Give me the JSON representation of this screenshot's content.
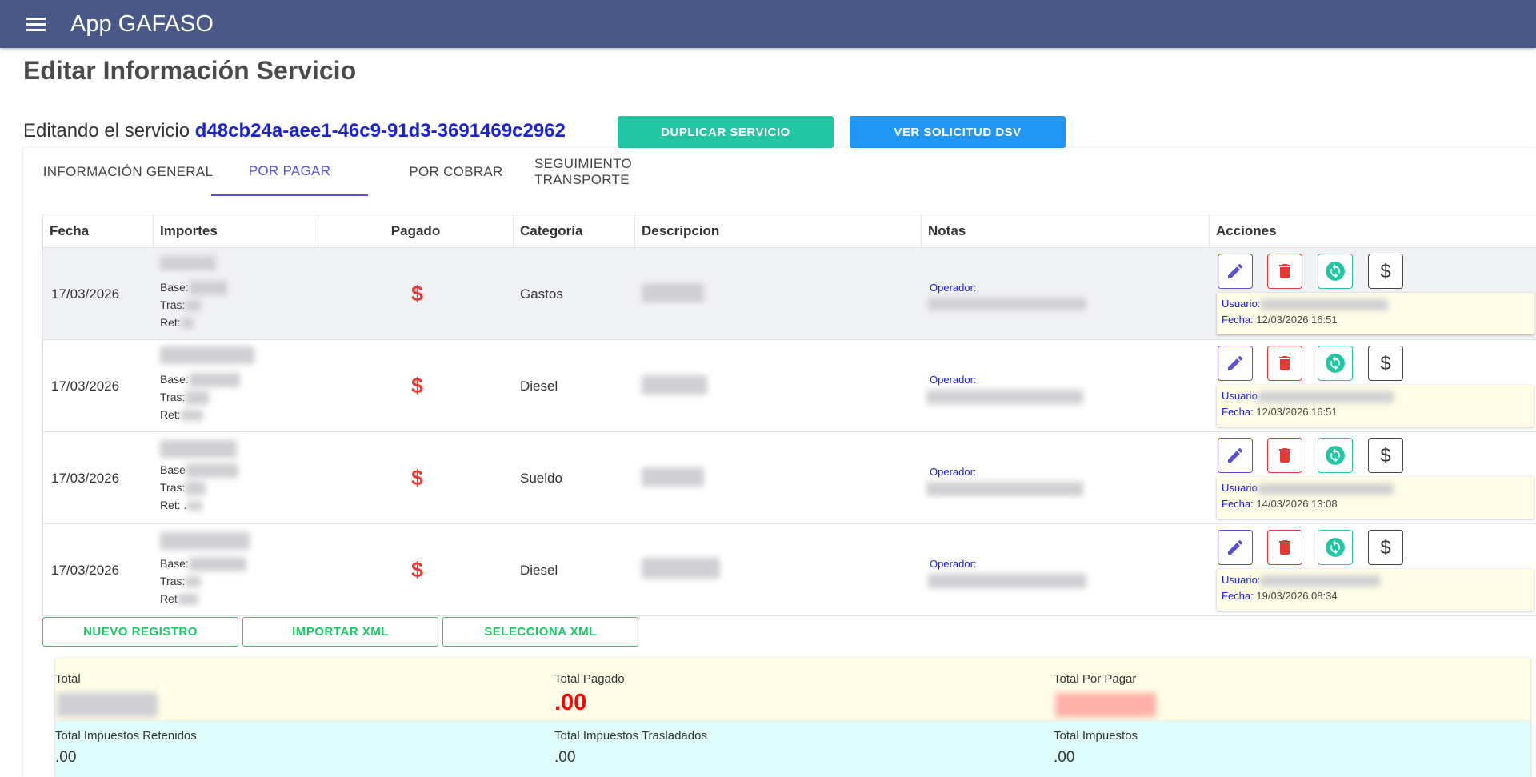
{
  "app": {
    "title": "App GAFASO"
  },
  "page": {
    "title": "Editar Información Servicio",
    "editing_prefix": "Editando el servicio",
    "service_id": "d48cb24a-aee1-46c9-91d3-3691469c2962",
    "duplicate_label": "DUPLICAR SERVICIO",
    "view_dsv_label": "VER SOLICITUD DSV"
  },
  "tabs": [
    {
      "label": "INFORMACIÓN GENERAL",
      "active": false
    },
    {
      "label": "POR PAGAR",
      "active": true
    },
    {
      "label": "POR COBRAR",
      "active": false
    },
    {
      "label": "SEGUIMIENTO TRANSPORTE",
      "active": false
    }
  ],
  "table": {
    "headers": [
      "Fecha",
      "Importes",
      "Pagado",
      "Categoría",
      "Descripcion",
      "Notas",
      "Acciones"
    ],
    "rows": [
      {
        "fecha": "17/03/2026",
        "importes": {
          "base": "Base:",
          "tras": "Tras:",
          "ret": "Ret:"
        },
        "pagado": "$",
        "categoria": "Gastos",
        "nota_label": "Operador:",
        "usuario_label": "Usuario:",
        "fecha_label": "Fecha:",
        "fecha_val": "12/03/2026 16:51"
      },
      {
        "fecha": "17/03/2026",
        "importes": {
          "base": "Base:",
          "tras": "Tras:",
          "ret": "Ret:"
        },
        "pagado": "$",
        "categoria": "Diesel",
        "nota_label": "Operador:",
        "usuario_label": "Usuario",
        "fecha_label": "Fecha:",
        "fecha_val": "12/03/2026 16:51"
      },
      {
        "fecha": "17/03/2026",
        "importes": {
          "base": "Base",
          "tras": "Tras:",
          "ret": "Ret: ."
        },
        "pagado": "$",
        "categoria": "Sueldo",
        "nota_label": "Operador:",
        "usuario_label": "Usuario",
        "fecha_label": "Fecha:",
        "fecha_val": "14/03/2026 13:08"
      },
      {
        "fecha": "17/03/2026",
        "importes": {
          "base": "Base:",
          "tras": "Tras:",
          "ret": "Ret"
        },
        "pagado": "$",
        "categoria": "Diesel",
        "nota_label": "Operador:",
        "usuario_label": "Usuario:",
        "fecha_label": "Fecha:",
        "fecha_val": "19/03/2026 08:34"
      }
    ]
  },
  "actions": {
    "nuevo": "NUEVO REGISTRO",
    "importar": "IMPORTAR XML",
    "selecciona": "SELECCIONA XML"
  },
  "totals": {
    "total_label": "Total",
    "total_pagado_label": "Total Pagado",
    "total_pagado_val": ".00",
    "total_por_pagar_label": "Total Por Pagar",
    "ret_label": "Total Impuestos Retenidos",
    "ret_val": ".00",
    "tras_label": "Total Impuestos Trasladados",
    "tras_val": ".00",
    "imp_label": "Total Impuestos",
    "imp_val": ".00"
  },
  "colors": {
    "appbar": "#4a5887",
    "accent": "#5b4fd6",
    "duplicate": "#22c6a3",
    "dsv": "#2196f3",
    "danger": "#e53935",
    "success": "#1ec865"
  },
  "icons": [
    "menu-icon",
    "pencil-icon",
    "trash-icon",
    "sync-icon",
    "dollar-icon"
  ]
}
